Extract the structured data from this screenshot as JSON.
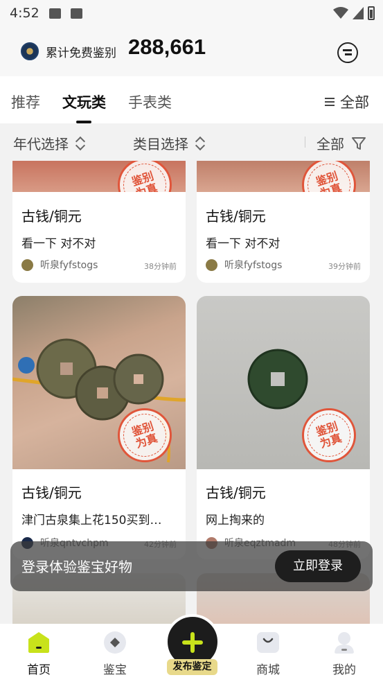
{
  "status_bar": {
    "time": "4:52"
  },
  "header": {
    "label": "累计免费鉴别",
    "count": "288,661"
  },
  "tabs": [
    {
      "label": "推荐"
    },
    {
      "label": "文玩类"
    },
    {
      "label": "手表类"
    }
  ],
  "tab_all_label": "全部",
  "filters": {
    "era": "年代选择",
    "category": "类目选择",
    "all": "全部"
  },
  "stamp_text": {
    "line1": "鉴别",
    "line2": "为真"
  },
  "cards": [
    {
      "category": "古钱/铜元",
      "title": "看一下 对不对",
      "user": "听泉fyfstogs",
      "time": "38分钟前"
    },
    {
      "category": "古钱/铜元",
      "title": "看一下 对不对",
      "user": "听泉fyfstogs",
      "time": "39分钟前"
    },
    {
      "category": "古钱/铜元",
      "title": "津门古泉集上花150买到…",
      "user": "听泉qntvchpm",
      "time": "42分钟前"
    },
    {
      "category": "古钱/铜元",
      "title": "网上掏来的",
      "user": "听泉eqztmadm",
      "time": "48分钟前"
    }
  ],
  "login_banner": {
    "text": "登录体验鉴宝好物",
    "button": "立即登录"
  },
  "bottom_nav": {
    "home": "首页",
    "appraise": "鉴宝",
    "publish": "发布鉴定",
    "mall": "商城",
    "mine": "我的"
  },
  "colors": {
    "accent_lime": "#c8e21b",
    "stamp_red": "#e0553a",
    "publish_tag": "#e8d98a"
  }
}
